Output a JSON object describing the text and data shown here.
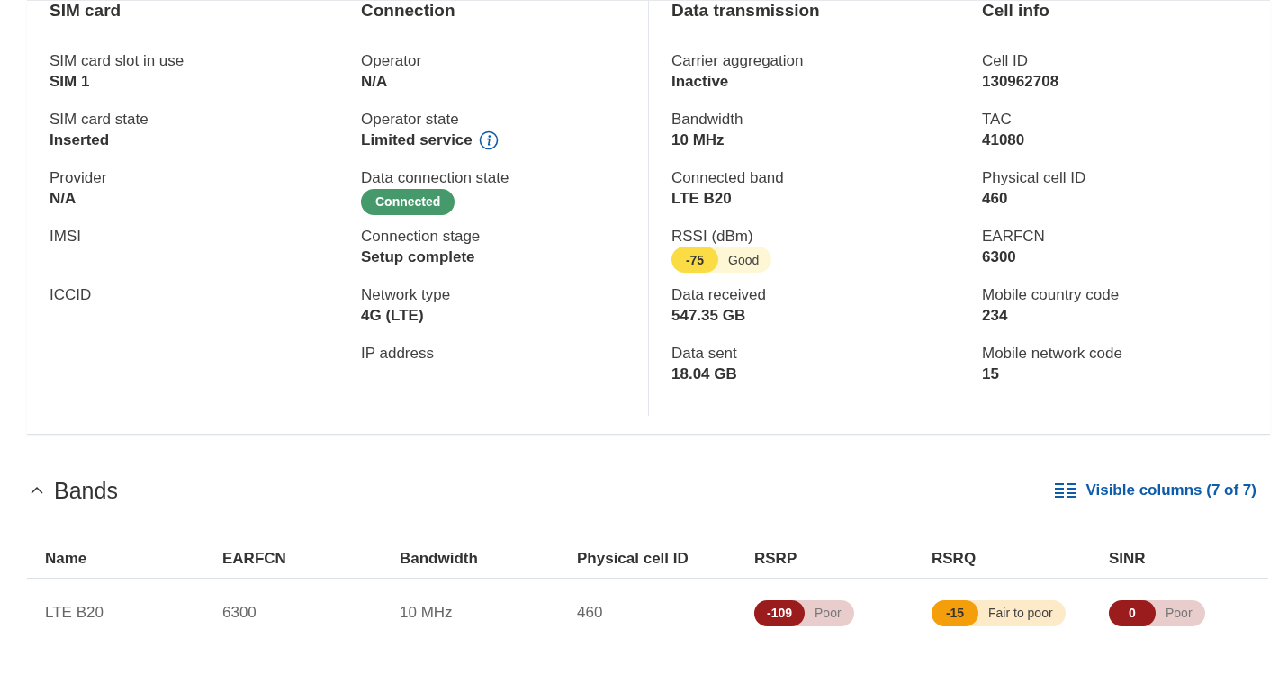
{
  "sections": [
    {
      "title": "SIM card",
      "fields": [
        {
          "kind": "text",
          "label": "SIM card slot in use",
          "value": "SIM 1"
        },
        {
          "kind": "text",
          "label": "SIM card state",
          "value": "Inserted"
        },
        {
          "kind": "text",
          "label": "Provider",
          "value": "N/A"
        },
        {
          "kind": "empty",
          "label": "IMSI"
        },
        {
          "kind": "empty",
          "label": "ICCID"
        }
      ]
    },
    {
      "title": "Connection",
      "fields": [
        {
          "kind": "text",
          "label": "Operator",
          "value": "N/A"
        },
        {
          "kind": "info",
          "label": "Operator state",
          "value": "Limited service"
        },
        {
          "kind": "status",
          "label": "Data connection state",
          "value": "Connected",
          "color": "#45996b"
        },
        {
          "kind": "text",
          "label": "Connection stage",
          "value": "Setup complete"
        },
        {
          "kind": "text",
          "label": "Network type",
          "value": "4G (LTE)"
        },
        {
          "kind": "empty",
          "label": "IP address"
        }
      ]
    },
    {
      "title": "Data transmission",
      "fields": [
        {
          "kind": "text",
          "label": "Carrier aggregation",
          "value": "Inactive"
        },
        {
          "kind": "text",
          "label": "Bandwidth",
          "value": "10 MHz"
        },
        {
          "kind": "text",
          "label": "Connected band",
          "value": "LTE B20"
        },
        {
          "kind": "signal",
          "label": "RSSI (dBm)",
          "value": "-75",
          "rating": "Good",
          "color": "#fbdc45"
        },
        {
          "kind": "text",
          "label": "Data received",
          "value": "547.35 GB"
        },
        {
          "kind": "text",
          "label": "Data sent",
          "value": "18.04 GB"
        }
      ]
    },
    {
      "title": "Cell info",
      "fields": [
        {
          "kind": "text",
          "label": "Cell ID",
          "value": "130962708"
        },
        {
          "kind": "text",
          "label": "TAC",
          "value": "41080"
        },
        {
          "kind": "text",
          "label": "Physical cell ID",
          "value": "460"
        },
        {
          "kind": "text",
          "label": "EARFCN",
          "value": "6300"
        },
        {
          "kind": "text",
          "label": "Mobile country code",
          "value": "234"
        },
        {
          "kind": "text",
          "label": "Mobile network code",
          "value": "15"
        }
      ]
    }
  ],
  "bands": {
    "title": "Bands",
    "expanded": true,
    "columns_button": "Visible columns (7 of 7)",
    "columns": [
      "Name",
      "EARFCN",
      "Bandwidth",
      "Physical cell ID",
      "RSRP",
      "RSRQ",
      "SINR"
    ],
    "rows": [
      {
        "cells": [
          {
            "kind": "text",
            "value": "LTE B20"
          },
          {
            "kind": "text",
            "value": "6300"
          },
          {
            "kind": "text",
            "value": "10 MHz"
          },
          {
            "kind": "text",
            "value": "460"
          },
          {
            "kind": "signal",
            "value": "-109",
            "rating": "Poor",
            "color": "#9b1c1c"
          },
          {
            "kind": "signal",
            "value": "-15",
            "rating": "Fair to poor",
            "color": "#f59e0b"
          },
          {
            "kind": "signal",
            "value": "0",
            "rating": "Poor",
            "color": "#9b1c1c"
          }
        ]
      }
    ]
  }
}
